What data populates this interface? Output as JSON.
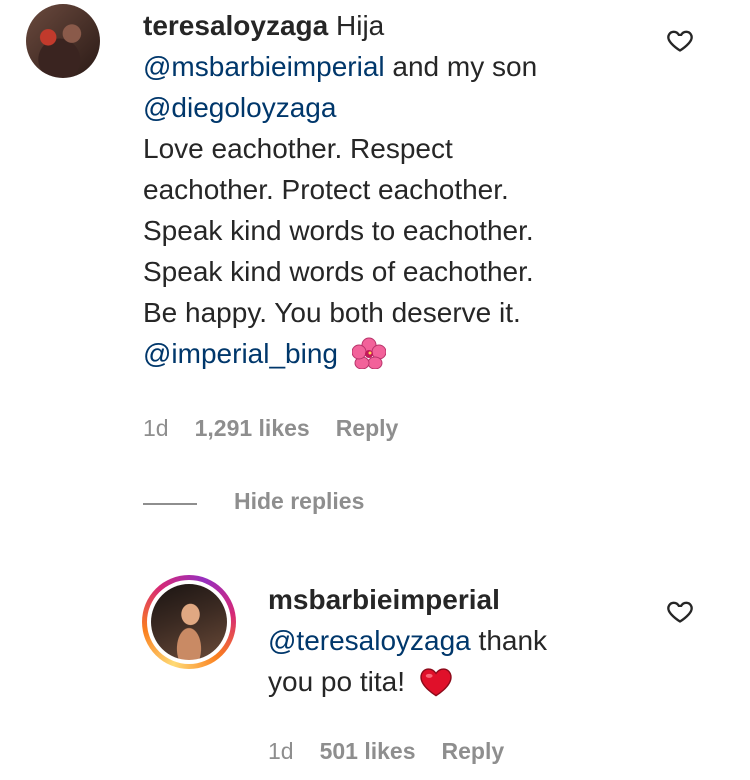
{
  "comment": {
    "username": "teresaloyzaga",
    "first_word": "Hija",
    "mention_1": "@msbarbieimperial",
    "after_mention_1": "and my son",
    "mention_2": "@diegoloyzaga",
    "body_lines": [
      "Love eachother. Respect",
      "eachother. Protect eachother.",
      "Speak kind words to eachother.",
      "Speak kind words of eachother.",
      "Be happy. You both deserve it."
    ],
    "mention_3": "@imperial_bing",
    "emoji": "hibiscus",
    "time": "1d",
    "likes": "1,291 likes",
    "reply_label": "Reply"
  },
  "replies_toggle": {
    "label": "Hide replies"
  },
  "reply": {
    "username": "msbarbieimperial",
    "mention": "@teresaloyzaga",
    "text_after_mention": "thank",
    "text_line_2": "you po tita!",
    "emoji": "red-heart",
    "time": "1d",
    "likes": "501 likes",
    "reply_label": "Reply"
  },
  "colors": {
    "mention": "#00376b",
    "meta": "#8e8e8e",
    "heart_emoji": "#e0102a",
    "hibiscus": "#f2629a"
  }
}
